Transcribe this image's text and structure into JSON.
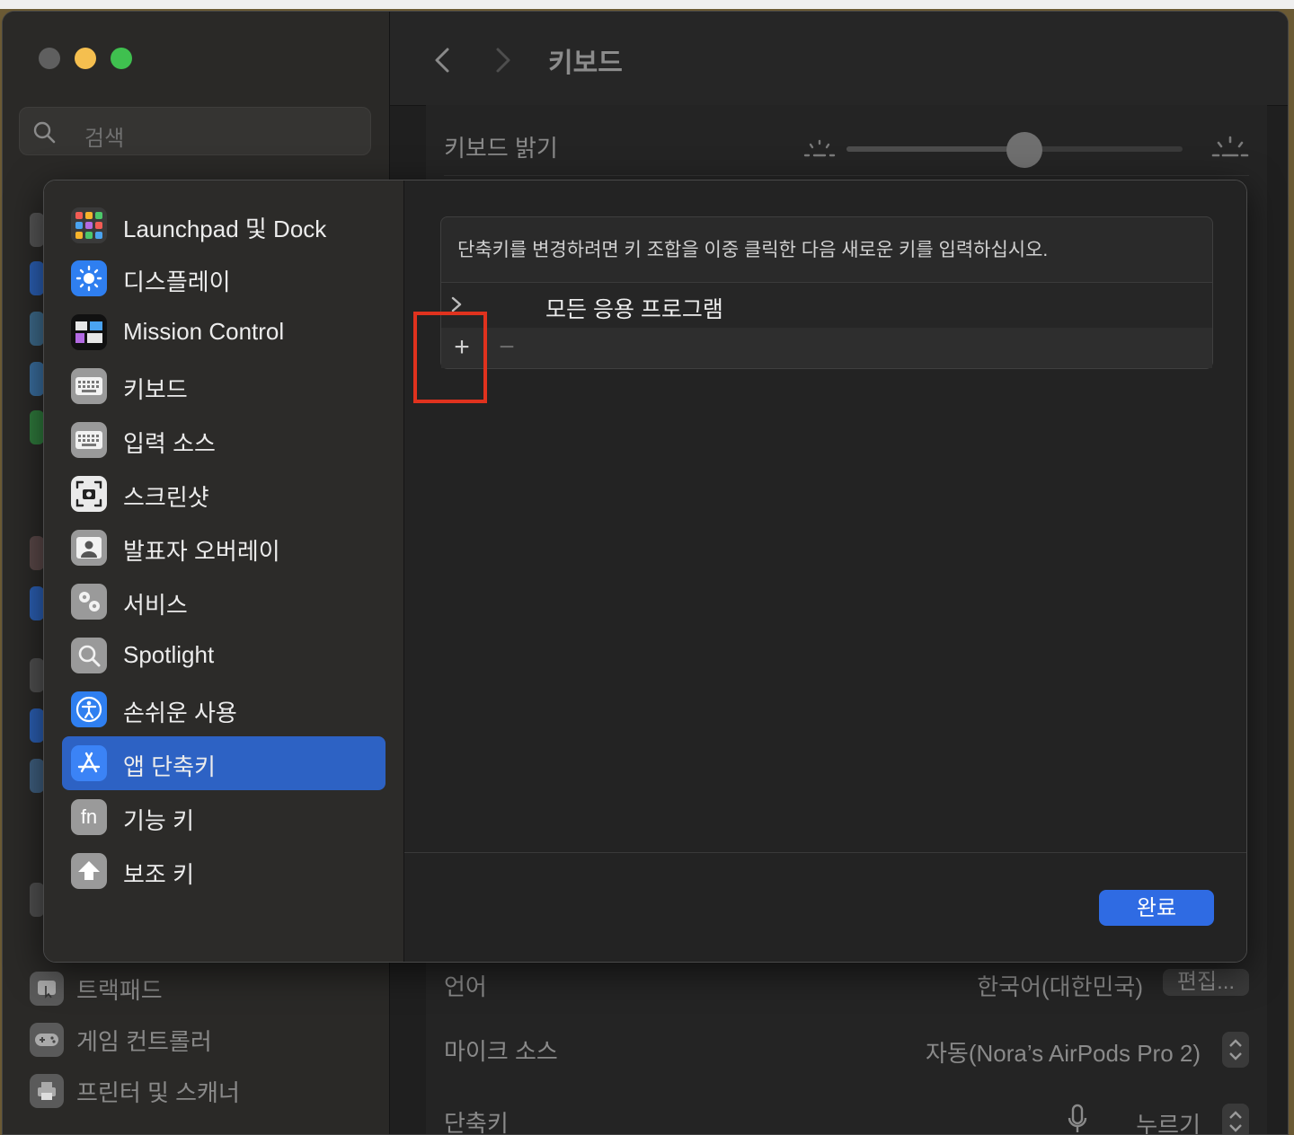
{
  "window": {
    "title": "키보드"
  },
  "search": {
    "placeholder": "검색"
  },
  "sidebar_bottom": [
    {
      "label": "트랙패드",
      "icon": "trackpad-icon"
    },
    {
      "label": "게임 컨트롤러",
      "icon": "gamepad-icon"
    },
    {
      "label": "프린터 및 스캐너",
      "icon": "printer-icon"
    }
  ],
  "main": {
    "brightness_label": "키보드 밝기",
    "brightness_level": 0.53,
    "partial_row_label": "언어",
    "partial_row_value": "한국어(대한민국)",
    "edit_label": "편집...",
    "mic_label": "마이크 소스",
    "mic_value": "자동(Nora’s AirPods Pro 2)",
    "shortcut_label": "단축키",
    "shortcut_value": "누르기"
  },
  "sheet": {
    "categories": [
      {
        "label": "Launchpad 및 Dock",
        "icon": "launchpad-icon"
      },
      {
        "label": "디스플레이",
        "icon": "display-icon"
      },
      {
        "label": "Mission Control",
        "icon": "mission-control-icon"
      },
      {
        "label": "키보드",
        "icon": "keyboard-icon"
      },
      {
        "label": "입력 소스",
        "icon": "input-sources-icon"
      },
      {
        "label": "스크린샷",
        "icon": "screenshot-icon"
      },
      {
        "label": "발표자 오버레이",
        "icon": "presenter-overlay-icon"
      },
      {
        "label": "서비스",
        "icon": "services-icon"
      },
      {
        "label": "Spotlight",
        "icon": "spotlight-icon"
      },
      {
        "label": "손쉬운 사용",
        "icon": "accessibility-icon"
      },
      {
        "label": "앱 단축키",
        "icon": "app-shortcuts-icon",
        "selected": true
      },
      {
        "label": "기능 키",
        "icon": "function-keys-icon",
        "glyph": "fn"
      },
      {
        "label": "보조 키",
        "icon": "modifier-keys-icon"
      }
    ],
    "hint": "단축키를 변경하려면 키 조합을 이중 클릭한 다음 새로운 키를 입력하십시오.",
    "row_label": "모든 응용 프로그램",
    "plus": "+",
    "minus": "−",
    "done_label": "완료"
  },
  "colors": {
    "accent": "#2f6be3",
    "selection": "#2d62c4",
    "highlight": "#e0321e"
  }
}
